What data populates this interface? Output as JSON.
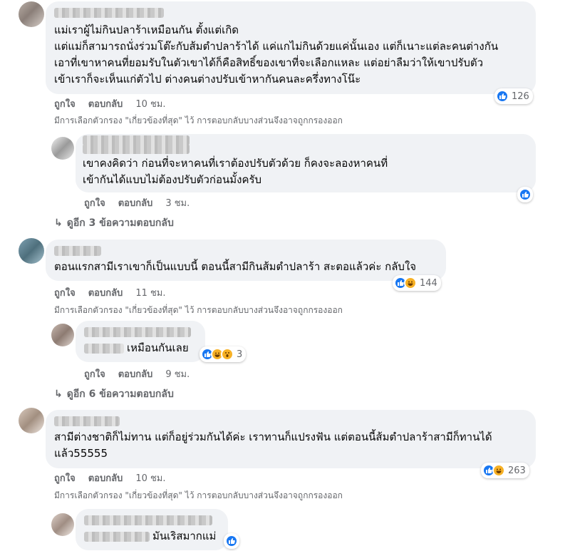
{
  "actions": {
    "like": "ถูกใจ",
    "reply": "ตอบกลับ"
  },
  "filter_note": "มีการเลือกตัวกรอง \"เกี่ยวข้องที่สุด\" ไว้ การตอบกลับบางส่วนจึงอาจถูกกรองออก",
  "comments": [
    {
      "text": "แม่เราผู้ไม่กินปลาร้าเหมือนกัน ตั้งแต่เกิด\nแต่แม่ก็สามารถนั่งร่วมโต๊ะกับส้มตำปลาร้าได้ แค่แกไม่กินด้วยแค่นั้นเอง แต่ก็เนาะแต่ละคนต่างกัน\nเอาที่เขาหาคนที่ยอมรับในตัวเขาได้ก็คือสิทธิ์ของเขาที่จะเลือกแหละ แต่อย่าลืมว่าให้เขาปรับตัว\nเข้าเราก็จะเห็นแก่ตัวไป ต่างคนต่างปรับเข้าหากันคนละครึ่งทางโน๊ะ",
      "time": "10 ชม.",
      "reactions": {
        "count": "126",
        "types": [
          "like-icon"
        ]
      }
    },
    {
      "text": "เขาคงคิดว่า ก่อนที่จะหาคนที่เราต้องปรับตัวด้วย ก็คงจะลองหาคนที่\nเข้ากันได้แบบไม่ต้องปรับตัวก่อนมั้งครับ",
      "time": "3 ชม.",
      "reactions": {
        "count": "",
        "types": [
          "like-icon"
        ]
      }
    },
    {
      "text": "ตอนแรกสามีเราเขาก็เป็นแบบนี้ ตอนนี้สามีกินส้มตำปลาร้า สะตอแล้วค่ะ กลับใจ",
      "time": "11 ชม.",
      "reactions": {
        "count": "144",
        "types": [
          "like-icon",
          "haha-icon"
        ]
      }
    },
    {
      "text": "เหมือนกันเลย",
      "time": "9 ชม.",
      "reactions": {
        "count": "3",
        "types": [
          "like-icon",
          "haha-icon",
          "wow-icon"
        ]
      }
    },
    {
      "text": "สามีต่างชาติก็ไม่ทาน แต่ก็อยู่ร่วมกันได้ค่ะ เราทานก็แปรงฟัน แต่ตอนนี้ส้มตำปลาร้าสามีก็ทานได้\nแล้ว55555",
      "time": "10 ชม.",
      "reactions": {
        "count": "263",
        "types": [
          "like-icon",
          "haha-icon"
        ]
      }
    },
    {
      "text": "มันเริสมากแม่",
      "time": "",
      "reactions": {
        "count": "",
        "types": [
          "like-icon"
        ]
      }
    }
  ],
  "more_replies": [
    {
      "label": "ดูอีก 3 ข้อความตอบกลับ"
    },
    {
      "label": "ดูอีก 6 ข้อความตอบกลับ"
    }
  ],
  "colors": {
    "bubble": "#f0f2f5",
    "like": "#1877f2",
    "haha": "#f7b125",
    "meta": "#65676b"
  }
}
